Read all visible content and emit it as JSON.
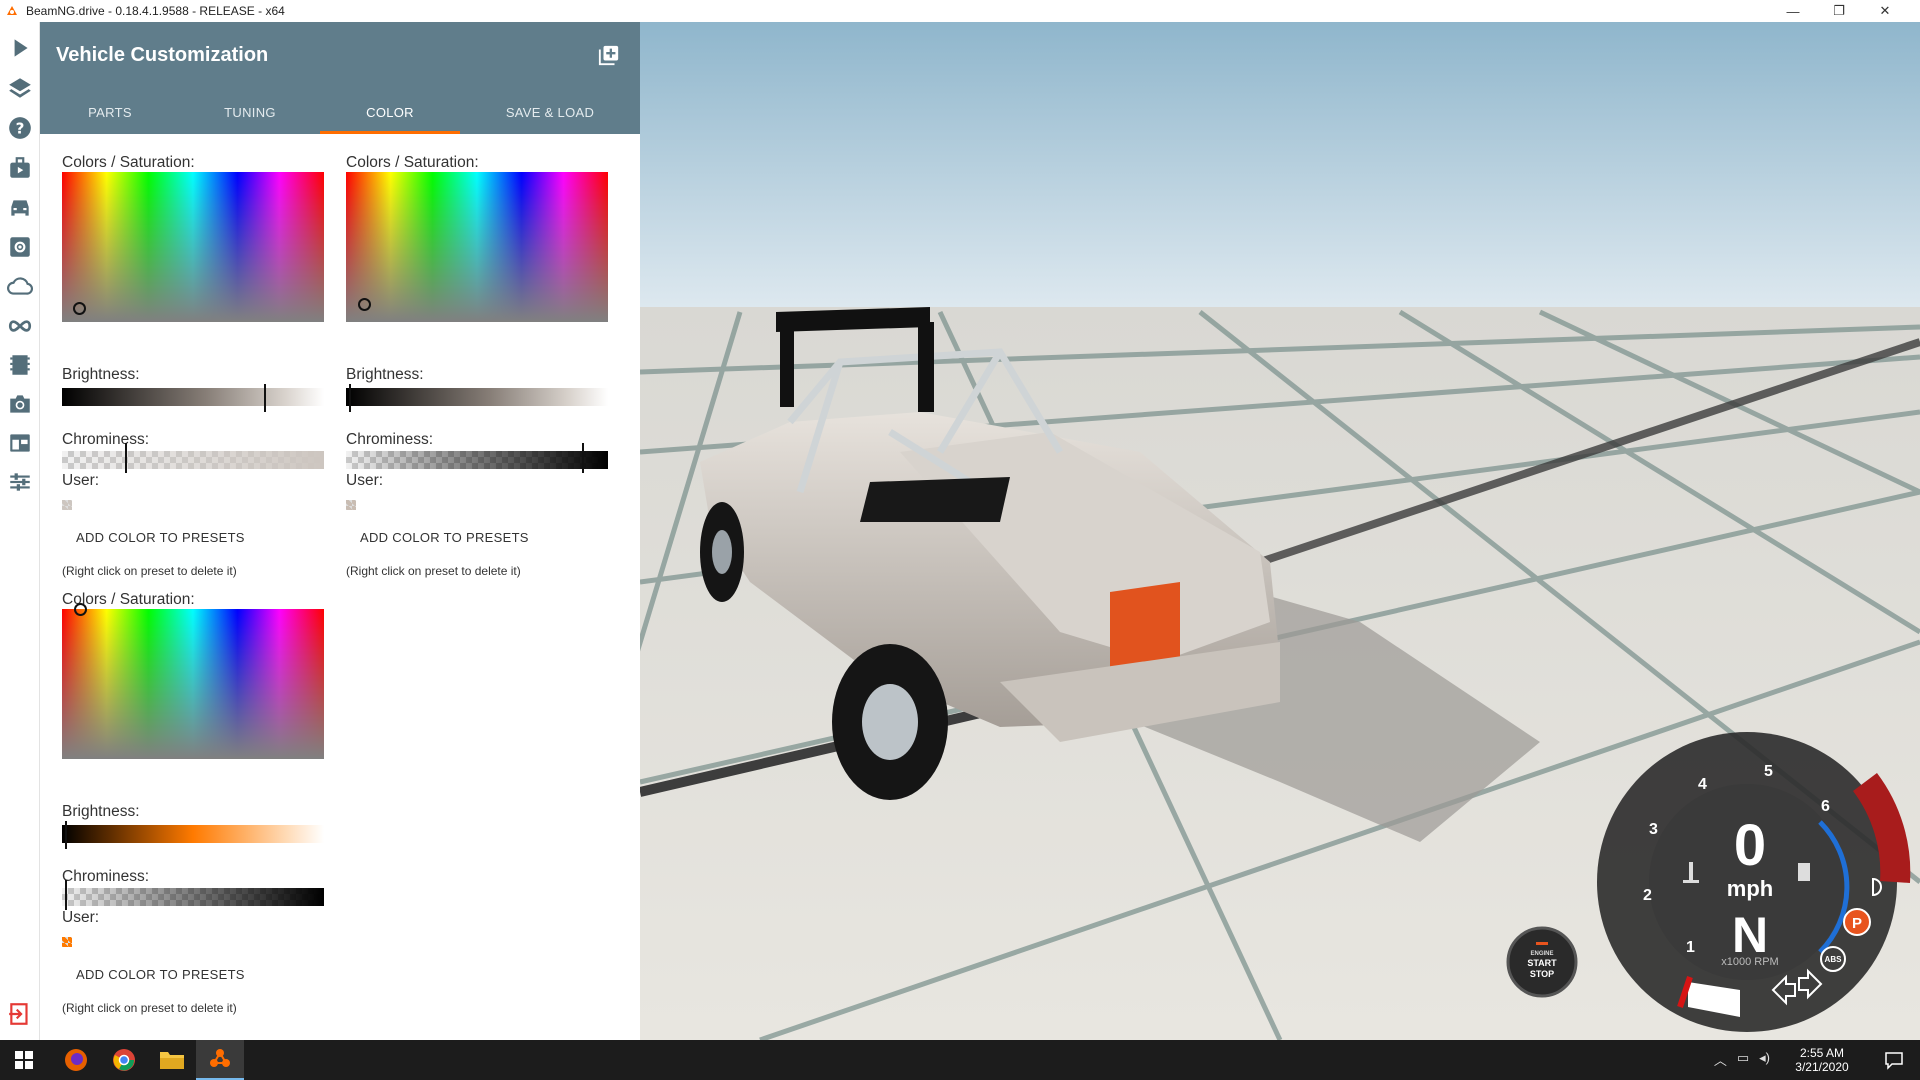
{
  "window": {
    "title": "BeamNG.drive - 0.18.4.1.9588 - RELEASE - x64",
    "minimize": "—",
    "maximize": "❐",
    "close": "✕"
  },
  "sidebar_icons": [
    "play-icon",
    "layers-icon",
    "help-icon",
    "missions-icon",
    "vehicles-icon",
    "vehicle-config-icon",
    "environment-icon",
    "track-builder-icon",
    "replay-icon",
    "photo-mode-icon",
    "ui-apps-icon",
    "options-icon",
    "exit-icon"
  ],
  "panel": {
    "title": "Vehicle Customization",
    "tabs": [
      {
        "label": "PARTS"
      },
      {
        "label": "TUNING"
      },
      {
        "label": "COLOR"
      },
      {
        "label": "SAVE & LOAD"
      }
    ],
    "active_tab": "COLOR",
    "pickers": [
      {
        "colors_label": "Colors / Saturation:",
        "brightness_label": "Brightness:",
        "chrominess_label": "Chrominess:",
        "user_label": "User:",
        "add_button": "ADD COLOR TO PRESETS",
        "hint": "(Right click on preset to delete it)",
        "brightness_value": 0.77,
        "chrominess_value": 0.24,
        "swatch_color": "#cdc6c0"
      },
      {
        "colors_label": "Colors / Saturation:",
        "brightness_label": "Brightness:",
        "chrominess_label": "Chrominess:",
        "user_label": "User:",
        "add_button": "ADD COLOR TO PRESETS",
        "hint": "(Right click on preset to delete it)",
        "brightness_value": 0.01,
        "chrominess_value": 0.9,
        "swatch_color": "#c9bdb3"
      },
      {
        "colors_label": "Colors / Saturation:",
        "brightness_label": "Brightness:",
        "chrominess_label": "Chrominess:",
        "user_label": "User:",
        "add_button": "ADD COLOR TO PRESETS",
        "hint": "(Right click on preset to delete it)",
        "brightness_value": 0.01,
        "chrominess_value": 0.01,
        "swatch_color": "#ff7a00"
      }
    ]
  },
  "hud": {
    "speed": "0",
    "speed_unit": "mph",
    "gear": "N",
    "rpm_label": "x1000 RPM",
    "rpm_ticks": [
      "1",
      "2",
      "3",
      "4",
      "5",
      "6"
    ],
    "parking_badge": "P",
    "abs_badge": "ABS",
    "engine_button": [
      "ENGINE",
      "START",
      "STOP"
    ]
  },
  "taskbar": {
    "time": "2:55 AM",
    "date": "3/21/2020",
    "apps": [
      "windows-start-icon",
      "firefox-icon",
      "chrome-icon",
      "file-explorer-icon",
      "beamng-icon"
    ]
  }
}
